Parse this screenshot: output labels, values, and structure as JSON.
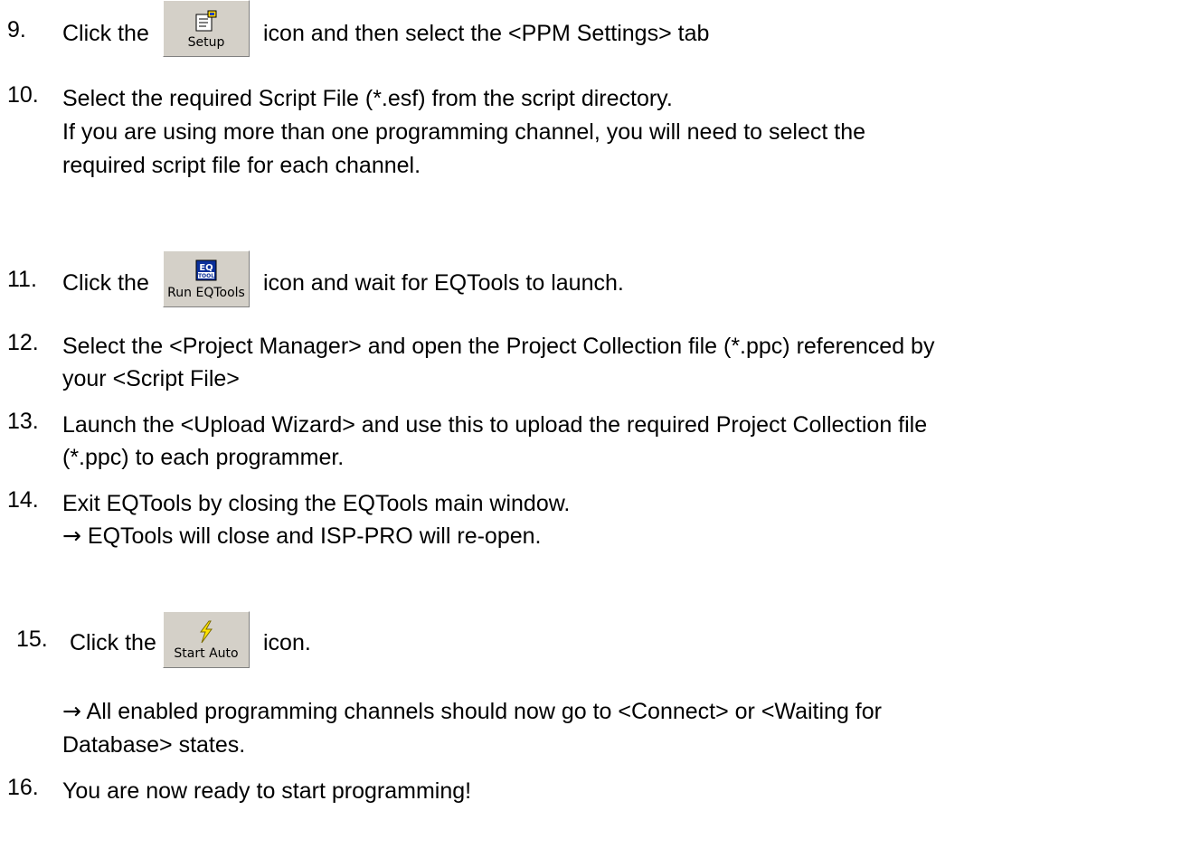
{
  "steps": {
    "s9": {
      "number": "9.",
      "before": "Click the",
      "after": "icon and then select the <PPM Settings> tab",
      "button": {
        "label": "Setup",
        "icon": "setup-icon"
      }
    },
    "s10": {
      "number": "10.",
      "lines": [
        "Select the required Script File (*.esf) from the script directory.",
        "If you are using more than one programming channel, you will need to select the",
        "required script file for each channel."
      ]
    },
    "s11": {
      "number": "11.",
      "before": "Click the",
      "after": "icon and wait for EQTools to launch.",
      "button": {
        "label": "Run EQTools",
        "icon": "eqtool-icon"
      }
    },
    "s12": {
      "number": "12.",
      "lines": [
        "Select the <Project Manager> and open the Project Collection file (*.ppc) referenced by",
        "your <Script File>"
      ]
    },
    "s13": {
      "number": "13.",
      "lines": [
        "Launch the <Upload Wizard> and use this to upload the required Project Collection file",
        "(*.ppc) to each programmer."
      ]
    },
    "s14": {
      "number": "14.",
      "lines": [
        "Exit EQTools by closing the EQTools main window.",
        "EQTools will close and ISP-PRO will re-open."
      ],
      "arrow": "→"
    },
    "s15": {
      "number": "15.",
      "before": "Click the",
      "after": "icon.",
      "button": {
        "label": "Start Auto",
        "icon": "lightning-icon"
      },
      "result_lines": [
        "All enabled programming channels should now go to <Connect> or <Waiting for",
        "Database> states."
      ],
      "arrow": "→"
    },
    "s16": {
      "number": "16.",
      "lines": [
        "You are now ready to start programming!"
      ]
    }
  },
  "colors": {
    "button_face": "#d4d0c8",
    "text": "#000000"
  }
}
